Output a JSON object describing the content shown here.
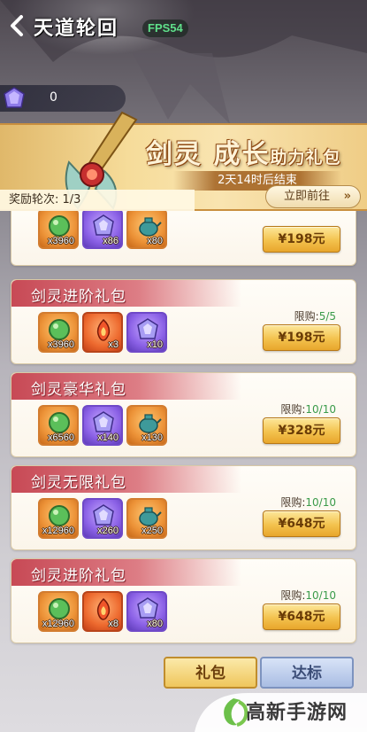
{
  "header": {
    "title": "天道轮回",
    "fps": "FPS54"
  },
  "currency": {
    "icon": "gem-icon",
    "value": "0"
  },
  "banner": {
    "title_main": "剑灵 成长",
    "title_sub": "助力礼包",
    "countdown": "2天14时后结束",
    "round_label": "奖励轮次: 1/3",
    "go_button": "立即前往",
    "go_arrow": "»"
  },
  "colors": {
    "accent_gold": "#f3c24e",
    "header_red": "#c74955",
    "limit_green": "#3a9b4a"
  },
  "packs": [
    {
      "title": "",
      "items": [
        {
          "icon": "green-orb-icon",
          "type": "orange",
          "count": "x3960"
        },
        {
          "icon": "purple-crystal-icon",
          "type": "purple",
          "count": "x86"
        },
        {
          "icon": "teapot-icon",
          "type": "orange",
          "count": "x80"
        }
      ],
      "limit_label": "",
      "limit_value": "",
      "price": "¥198元"
    },
    {
      "title": "剑灵进阶礼包",
      "items": [
        {
          "icon": "green-orb-icon",
          "type": "orange",
          "count": "x3960"
        },
        {
          "icon": "fire-stone-icon",
          "type": "red",
          "count": "x3"
        },
        {
          "icon": "purple-crystal-icon",
          "type": "purple",
          "count": "x10"
        }
      ],
      "limit_label": "限购:",
      "limit_value": "5/5",
      "price": "¥198元"
    },
    {
      "title": "剑灵豪华礼包",
      "items": [
        {
          "icon": "green-orb-icon",
          "type": "orange",
          "count": "x6560"
        },
        {
          "icon": "purple-crystal-icon",
          "type": "purple",
          "count": "x140"
        },
        {
          "icon": "teapot-icon",
          "type": "orange",
          "count": "x130"
        }
      ],
      "limit_label": "限购:",
      "limit_value": "10/10",
      "price": "¥328元"
    },
    {
      "title": "剑灵无限礼包",
      "items": [
        {
          "icon": "green-orb-icon",
          "type": "orange",
          "count": "x12960"
        },
        {
          "icon": "purple-crystal-icon",
          "type": "purple",
          "count": "x260"
        },
        {
          "icon": "teapot-icon",
          "type": "orange",
          "count": "x250"
        }
      ],
      "limit_label": "限购:",
      "limit_value": "10/10",
      "price": "¥648元"
    },
    {
      "title": "剑灵进阶礼包",
      "items": [
        {
          "icon": "green-orb-icon",
          "type": "orange",
          "count": "x12960"
        },
        {
          "icon": "fire-stone-icon",
          "type": "red",
          "count": "x8"
        },
        {
          "icon": "purple-crystal-icon",
          "type": "purple",
          "count": "x80"
        }
      ],
      "limit_label": "限购:",
      "limit_value": "10/10",
      "price": "¥648元"
    }
  ],
  "tabs": {
    "gift": "礼包",
    "target": "达标"
  },
  "watermark": {
    "text": "高新手游网"
  }
}
